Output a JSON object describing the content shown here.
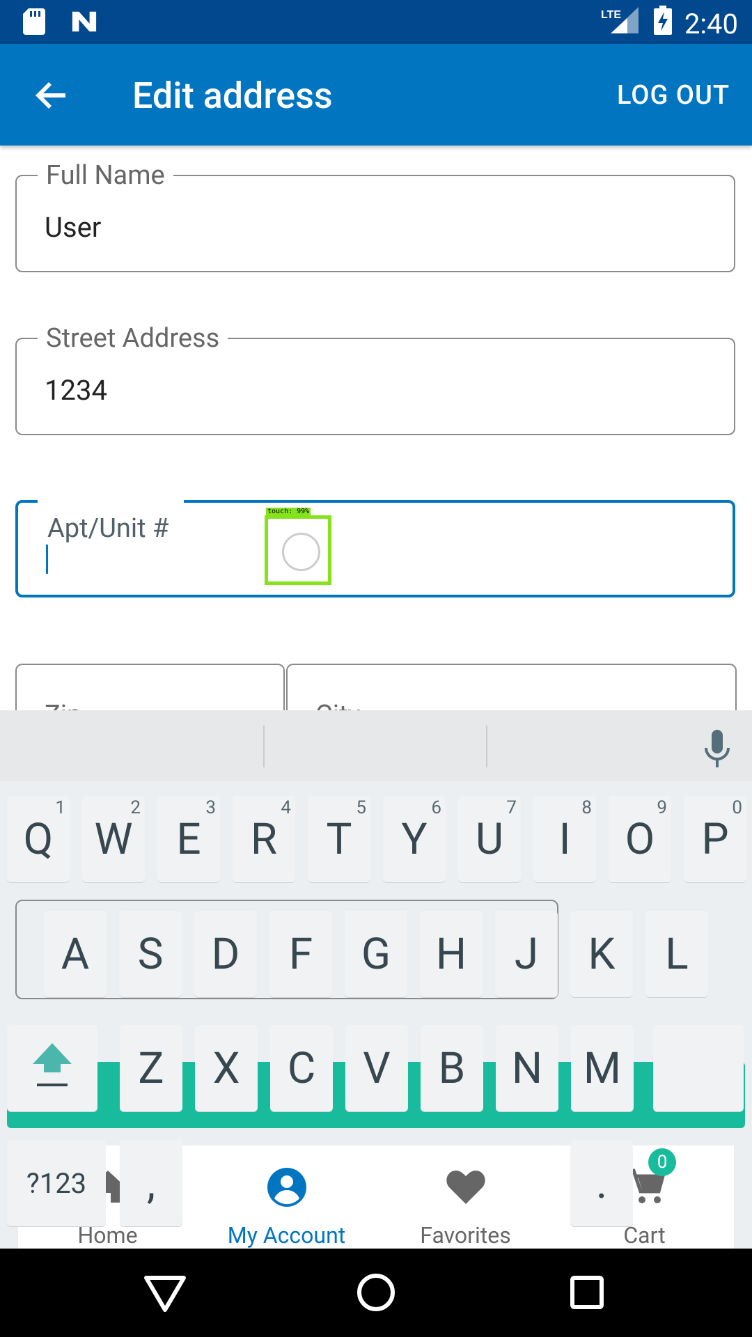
{
  "status_bar": {
    "time": "2:40",
    "network": "LTE"
  },
  "app_bar": {
    "title": "Edit address",
    "logout_label": "LOG OUT"
  },
  "form": {
    "full_name": {
      "label": "Full Name",
      "value": "User"
    },
    "street_address": {
      "label": "Street Address",
      "value": "1234"
    },
    "apt_unit": {
      "label": "Apt/Unit #",
      "value": ""
    },
    "zip": {
      "label": "Zip"
    },
    "city": {
      "label": "City"
    }
  },
  "touch_indicator": {
    "label": "touch: 99%"
  },
  "keyboard": {
    "row1": [
      {
        "key": "Q",
        "hint": "1"
      },
      {
        "key": "W",
        "hint": "2"
      },
      {
        "key": "E",
        "hint": "3"
      },
      {
        "key": "R",
        "hint": "4"
      },
      {
        "key": "T",
        "hint": "5"
      },
      {
        "key": "Y",
        "hint": "6"
      },
      {
        "key": "U",
        "hint": "7"
      },
      {
        "key": "I",
        "hint": "8"
      },
      {
        "key": "O",
        "hint": "9"
      },
      {
        "key": "P",
        "hint": "0"
      }
    ],
    "row2": [
      "A",
      "S",
      "D",
      "F",
      "G",
      "H",
      "J",
      "K",
      "L"
    ],
    "row3": [
      "Z",
      "X",
      "C",
      "V",
      "B",
      "N",
      "M"
    ],
    "symbols_label": "?123",
    "comma": ",",
    "period": "."
  },
  "bottom_nav": {
    "home_label": "Home",
    "account_label": "My Account",
    "favorites_label": "Favorites",
    "cart_label": "Cart",
    "cart_count": "0"
  },
  "colors": {
    "primary": "#0275c1",
    "status": "#01488f",
    "accent": "#18bc9c",
    "touch": "#86e21b"
  }
}
